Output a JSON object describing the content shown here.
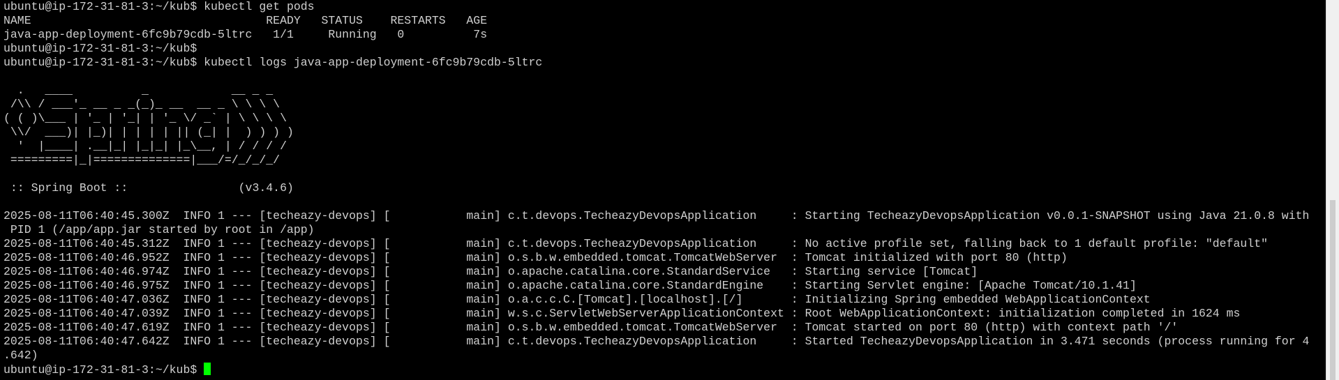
{
  "terminal": {
    "cursor_color": "#00ff00",
    "background": "#000000",
    "foreground": "#cfcfcf",
    "lines": [
      "ubuntu@ip-172-31-81-3:~/kub$ kubectl get pods",
      "NAME                                  READY   STATUS    RESTARTS   AGE",
      "java-app-deployment-6fc9b79cdb-5ltrc   1/1     Running   0          7s",
      "ubuntu@ip-172-31-81-3:~/kub$",
      "ubuntu@ip-172-31-81-3:~/kub$ kubectl logs java-app-deployment-6fc9b79cdb-5ltrc",
      "",
      "  .   ____          _            __ _ _",
      " /\\\\ / ___'_ __ _ _(_)_ __  __ _ \\ \\ \\ \\",
      "( ( )\\___ | '_ | '_| | '_ \\/ _` | \\ \\ \\ \\",
      " \\\\/  ___)| |_)| | | | | || (_| |  ) ) ) )",
      "  '  |____| .__|_| |_|_| |_\\__, | / / / /",
      " =========|_|==============|___/=/_/_/_/",
      "",
      " :: Spring Boot ::                (v3.4.6)",
      "",
      "2025-08-11T06:40:45.300Z  INFO 1 --- [techeazy-devops] [           main] c.t.devops.TecheazyDevopsApplication     : Starting TecheazyDevopsApplication v0.0.1-SNAPSHOT using Java 21.0.8 with",
      " PID 1 (/app/app.jar started by root in /app)",
      "2025-08-11T06:40:45.312Z  INFO 1 --- [techeazy-devops] [           main] c.t.devops.TecheazyDevopsApplication     : No active profile set, falling back to 1 default profile: \"default\"",
      "2025-08-11T06:40:46.952Z  INFO 1 --- [techeazy-devops] [           main] o.s.b.w.embedded.tomcat.TomcatWebServer  : Tomcat initialized with port 80 (http)",
      "2025-08-11T06:40:46.974Z  INFO 1 --- [techeazy-devops] [           main] o.apache.catalina.core.StandardService   : Starting service [Tomcat]",
      "2025-08-11T06:40:46.975Z  INFO 1 --- [techeazy-devops] [           main] o.apache.catalina.core.StandardEngine    : Starting Servlet engine: [Apache Tomcat/10.1.41]",
      "2025-08-11T06:40:47.036Z  INFO 1 --- [techeazy-devops] [           main] o.a.c.c.C.[Tomcat].[localhost].[/]       : Initializing Spring embedded WebApplicationContext",
      "2025-08-11T06:40:47.039Z  INFO 1 --- [techeazy-devops] [           main] w.s.c.ServletWebServerApplicationContext : Root WebApplicationContext: initialization completed in 1624 ms",
      "2025-08-11T06:40:47.619Z  INFO 1 --- [techeazy-devops] [           main] o.s.b.w.embedded.tomcat.TomcatWebServer  : Tomcat started on port 80 (http) with context path '/'",
      "2025-08-11T06:40:47.642Z  INFO 1 --- [techeazy-devops] [           main] c.t.devops.TecheazyDevopsApplication     : Started TecheazyDevopsApplication in 3.471 seconds (process running for 4",
      ".642)"
    ],
    "prompt": "ubuntu@ip-172-31-81-3:~/kub$ "
  }
}
